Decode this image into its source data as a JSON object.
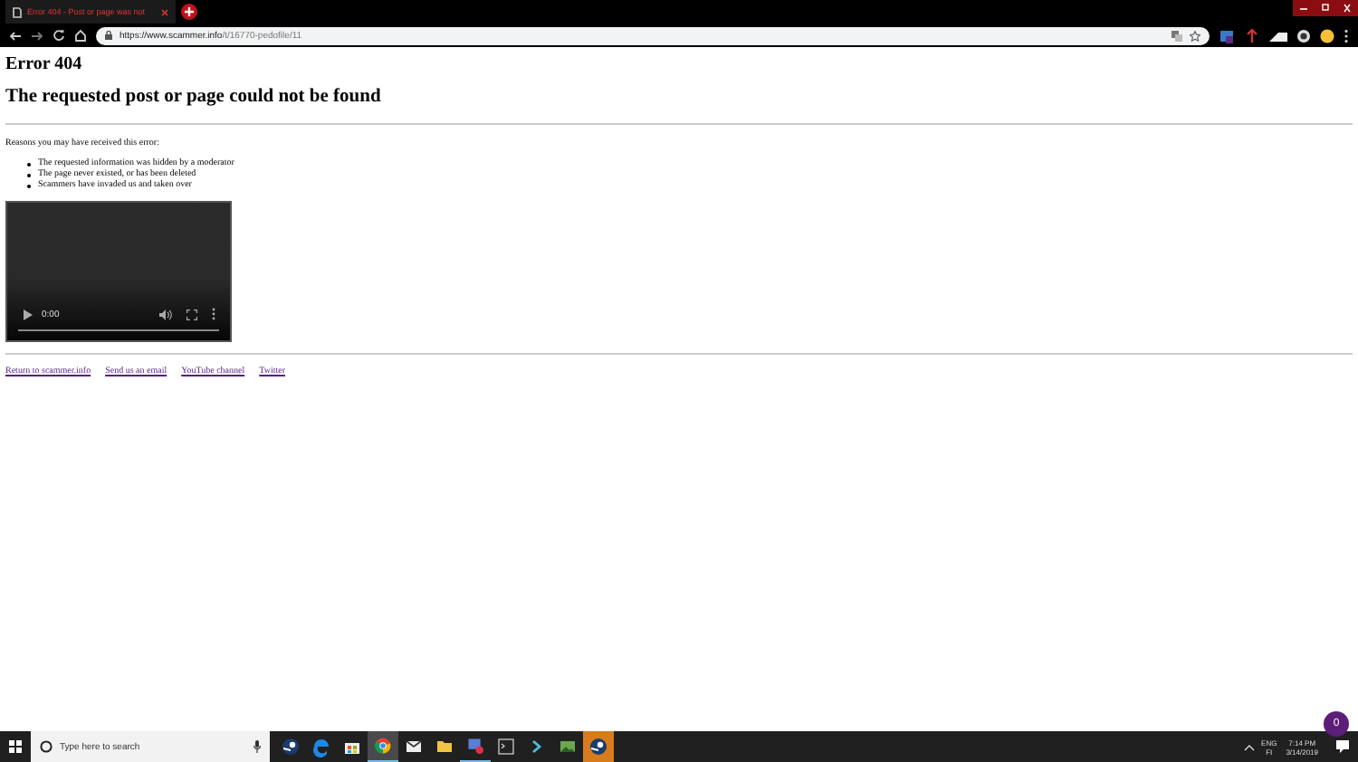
{
  "browser": {
    "tab": {
      "title": "Error 404 - Post or page was not"
    },
    "url": {
      "host": "https://www.scammer.info",
      "path": "/t/16770-pedofile/11"
    }
  },
  "page": {
    "heading": "Error 404",
    "subheading": "The requested post or page could not be found",
    "intro": "Reasons you may have received this error:",
    "reasons": [
      "The requested information was hidden by a moderator",
      "The page never existed, or has been deleted",
      "Scammers have invaded us and taken over"
    ],
    "video": {
      "time": "0:00",
      "level": 0
    },
    "links": [
      "Return to scammer.info",
      "Send us an email",
      "YouTube channel",
      "Twitter"
    ]
  },
  "taskbar": {
    "search": {
      "placeholder": "Type here to search"
    },
    "apps": [
      {
        "kind": "steam",
        "running": false,
        "focused": false,
        "flashing": false
      },
      {
        "kind": "edge",
        "running": false,
        "focused": false,
        "flashing": false
      },
      {
        "kind": "store",
        "running": false,
        "focused": false,
        "flashing": false
      },
      {
        "kind": "chrome",
        "running": true,
        "focused": true,
        "flashing": false
      },
      {
        "kind": "mail",
        "running": false,
        "focused": false,
        "flashing": false
      },
      {
        "kind": "folder",
        "running": false,
        "focused": false,
        "flashing": false
      },
      {
        "kind": "photos",
        "running": true,
        "focused": false,
        "flashing": false
      },
      {
        "kind": "terminal",
        "running": false,
        "focused": false,
        "flashing": false
      },
      {
        "kind": "arrow",
        "running": false,
        "focused": false,
        "flashing": false
      },
      {
        "kind": "image",
        "running": false,
        "focused": false,
        "flashing": false
      },
      {
        "kind": "steam",
        "running": false,
        "focused": false,
        "flashing": true
      }
    ],
    "language": [
      "ENG",
      "FI"
    ],
    "time": "7:14 PM",
    "date": "3/14/2019",
    "badge": "0"
  }
}
